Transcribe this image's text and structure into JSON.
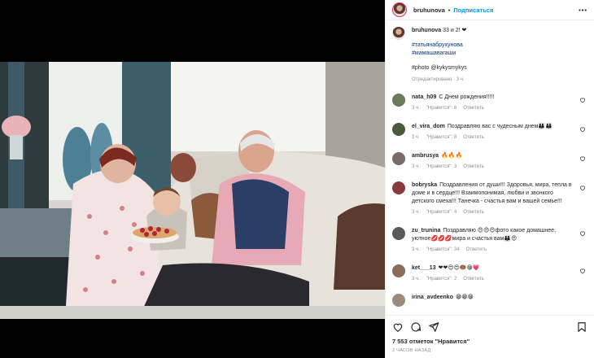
{
  "header": {
    "username": "bruhunova",
    "separator": "•",
    "follow_label": "Подписаться",
    "more_label": "•••"
  },
  "caption": {
    "username": "bruhunova",
    "text": "33 и 2! ❤",
    "hashtag1": "#татьянабрухунова",
    "hashtag2": "#мамашавагаши",
    "photo_credit": "#photo @kykysmykys",
    "edited": "Отредактировано · 3 ч."
  },
  "comments": [
    {
      "user": "nata_h09",
      "text": "С Днем рождения!!!!!",
      "time": "3 ч.",
      "likes": "\"Нравится\": 6",
      "reply": "Ответить",
      "color": "#6b7a5a"
    },
    {
      "user": "el_vira_dom",
      "text": "Поздравляю вас с чудесным днем👪👪",
      "time": "3 ч.",
      "likes": "\"Нравится\": 8",
      "reply": "Ответить",
      "color": "#4a5a3a"
    },
    {
      "user": "ambrusya",
      "text": "🔥🔥🔥",
      "time": "3 ч.",
      "likes": "\"Нравится\": 3",
      "reply": "Ответить",
      "color": "#7a6a6a"
    },
    {
      "user": "bobryska",
      "text": "Поздравления от души!!! Здоровья, мира, тепла в доме и в сердце!!! Взаимопонимая, любви и звонкого детского смеха!!! Танечка - счастья вам и вашей семье!!!",
      "time": "3 ч.",
      "likes": "\"Нравится\": 4",
      "reply": "Ответить",
      "color": "#8a3a3a"
    },
    {
      "user": "zu_trunina",
      "text": "Поздравляю 😍😍😍фото какое домашнее, уютное💋💋💋мира и счастья вам👪😍",
      "time": "3 ч.",
      "likes": "\"Нравится\": 34",
      "reply": "Ответить",
      "color": "#5a5a5a"
    },
    {
      "user": "ket___13",
      "text": "❤❤😍😍🍩😁💗",
      "time": "3 ч.",
      "likes": "\"Нравится\": 2",
      "reply": "Ответить",
      "color": "#8a6a5a"
    },
    {
      "user": "irina_avdeenko",
      "text": "😁😁😁",
      "time": "",
      "likes": "",
      "reply": "",
      "color": "#9a8a7a"
    }
  ],
  "footer": {
    "likes": "7 553 отметок \"Нравится\"",
    "ago": "2 ЧАСОВ НАЗАД"
  }
}
